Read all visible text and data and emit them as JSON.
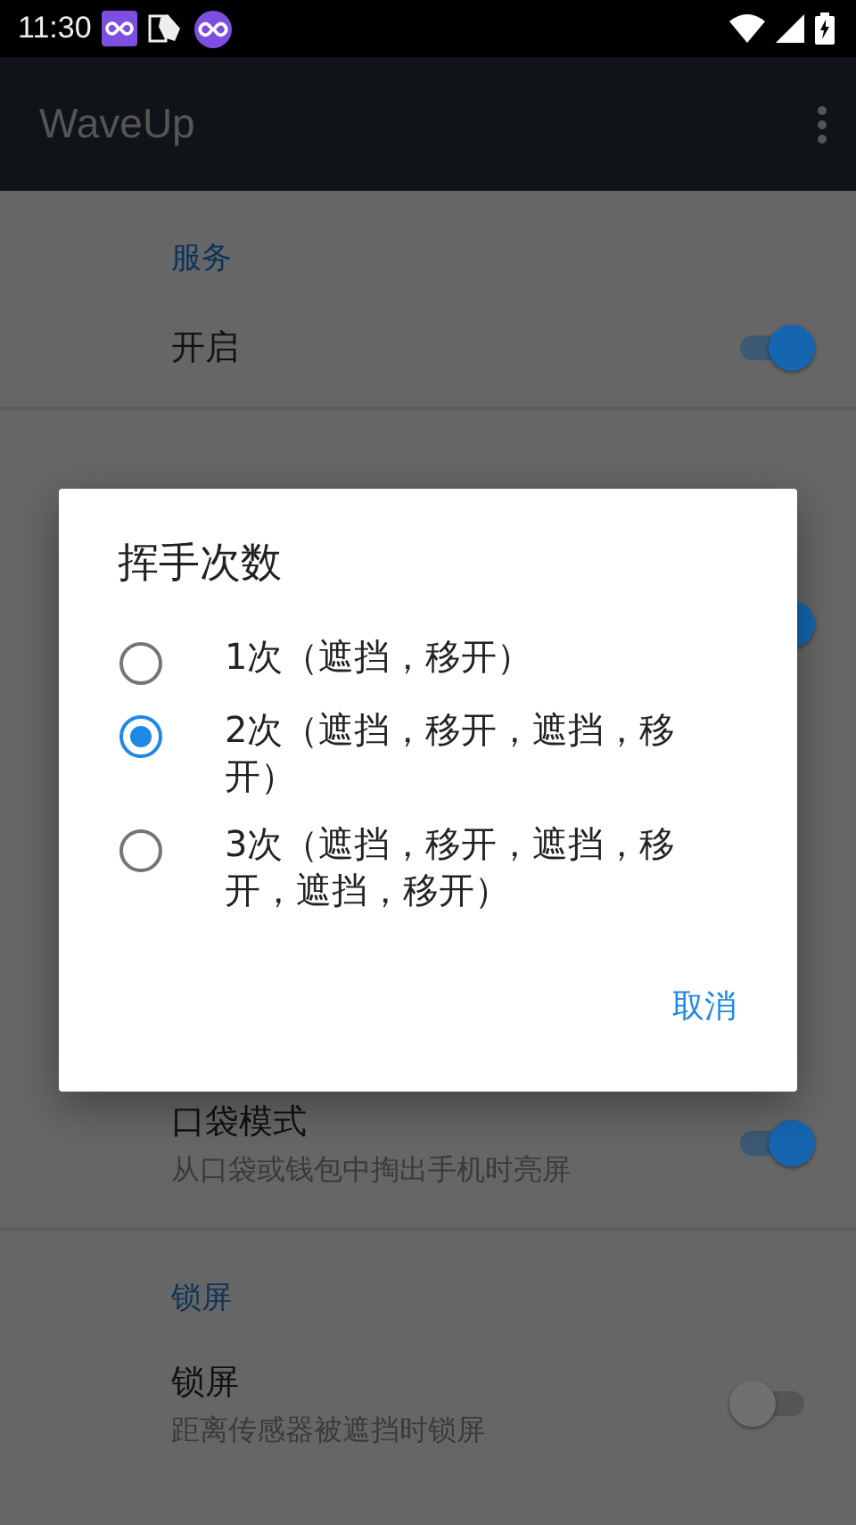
{
  "status_bar": {
    "time": "11:30"
  },
  "app_bar": {
    "title": "WaveUp"
  },
  "settings": [
    {
      "kind": "header",
      "label": "服务"
    },
    {
      "kind": "switch",
      "title": "开启",
      "on": true
    },
    {
      "kind": "divider"
    },
    {
      "kind": "covered_switch",
      "on": true
    },
    {
      "kind": "switch",
      "title": "口袋模式",
      "summary": "从口袋或钱包中掏出手机时亮屏",
      "on": true
    },
    {
      "kind": "divider"
    },
    {
      "kind": "header",
      "label": "锁屏"
    },
    {
      "kind": "switch",
      "title": "锁屏",
      "summary": "距离传感器被遮挡时锁屏",
      "on": false
    }
  ],
  "dialog": {
    "title": "挥手次数",
    "options": [
      {
        "label": "1次（遮挡，移开）",
        "selected": false
      },
      {
        "label": "2次（遮挡，移开，遮挡，移开）",
        "selected": true
      },
      {
        "label": "3次（遮挡，移开，遮挡，移开，遮挡，移开）",
        "selected": false
      }
    ],
    "button": "取消"
  }
}
